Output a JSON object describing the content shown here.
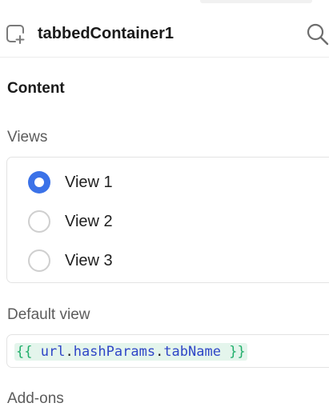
{
  "header": {
    "component_name": "tabbedContainer1",
    "component_icon": "container-add-icon",
    "search_icon": "search-icon"
  },
  "content": {
    "section_title": "Content",
    "views": {
      "label": "Views",
      "options": [
        {
          "label": "View 1",
          "selected": true
        },
        {
          "label": "View 2",
          "selected": false
        },
        {
          "label": "View 3",
          "selected": false
        }
      ]
    },
    "default_view": {
      "label": "Default view",
      "value": "{{ url.hashParams.tabName }}",
      "tokens": {
        "open": "{{",
        "obj": "url",
        "dot1": ".",
        "prop1": "hashParams",
        "dot2": ".",
        "prop2": "tabName",
        "close": "}}"
      }
    },
    "addons_label": "Add-ons"
  },
  "colors": {
    "accent": "#3b72e8",
    "code_brace": "#1fae6a",
    "code_ident": "#2f46c7",
    "code_bg": "#e4f5ec"
  }
}
